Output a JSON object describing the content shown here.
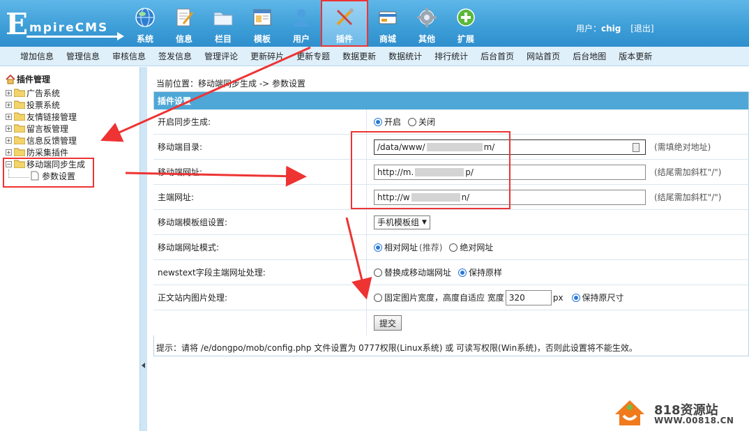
{
  "logo": {
    "initial": "E",
    "rest": "mpireCMS"
  },
  "main_nav": [
    {
      "label": "系统",
      "icon": "globe-icon"
    },
    {
      "label": "信息",
      "icon": "document-pen-icon"
    },
    {
      "label": "栏目",
      "icon": "folder-icon"
    },
    {
      "label": "模板",
      "icon": "window-icon"
    },
    {
      "label": "用户",
      "icon": "user-icon"
    },
    {
      "label": "插件",
      "icon": "tools-icon",
      "active": true
    },
    {
      "label": "商城",
      "icon": "card-icon"
    },
    {
      "label": "其他",
      "icon": "gear-icon"
    },
    {
      "label": "扩展",
      "icon": "plus-icon"
    }
  ],
  "user": {
    "prefix": "用户：",
    "name": "chig",
    "logout": "[退出]"
  },
  "sub_nav": [
    "增加信息",
    "管理信息",
    "审核信息",
    "签发信息",
    "管理评论",
    "更新碎片",
    "更新专题",
    "数据更新",
    "数据统计",
    "排行统计",
    "后台首页",
    "网站首页",
    "后台地图",
    "版本更新"
  ],
  "sidebar": {
    "title": "插件管理",
    "items": [
      "广告系统",
      "投票系统",
      "友情链接管理",
      "留言板管理",
      "信息反馈管理",
      "防采集插件",
      "移动端同步生成"
    ],
    "child": "参数设置"
  },
  "breadcrumb": "当前位置：移动端同步生成 -> 参数设置",
  "form": {
    "header": "插件设置",
    "sync_label": "开启同步生成:",
    "sync_on": "开启",
    "sync_off": "关闭",
    "dir_label": "移动端目录:",
    "dir_value": "/data/www/",
    "dir_value_end": "m/",
    "dir_note": "(需填绝对地址)",
    "mobile_url_label": "移动端网址:",
    "mobile_url_value": "http://m.",
    "mobile_url_end": "p/",
    "mobile_url_note": "(结尾需加斜杠\"/\")",
    "main_url_label": "主端网址:",
    "main_url_value": "http://w",
    "main_url_end": "n/",
    "main_url_note": "(结尾需加斜杠\"/\")",
    "template_label": "移动端模板组设置:",
    "template_value": "手机模板组",
    "url_mode_label": "移动端网址模式:",
    "url_mode_relative": "相对网址",
    "url_mode_relative_hint": "(推荐)",
    "url_mode_absolute": "绝对网址",
    "newstext_label": "newstext字段主端网址处理:",
    "newstext_replace": "替换成移动端网址",
    "newstext_keep": "保持原样",
    "image_label": "正文站内图片处理:",
    "image_fixed": "固定图片宽度，高度自适应 宽度",
    "image_width": "320",
    "image_unit": "px",
    "image_keep": "保持原尺寸",
    "submit": "提交"
  },
  "tip": "提示：请将 /e/dongpo/mob/config.php 文件设置为 0777权限(Linux系统) 或 可读写权限(Win系统)，否则此设置将不能生效。",
  "watermark": {
    "name": "818资源站",
    "url": "WWW.00818.CN"
  },
  "colors": {
    "header": "#3f9fd8",
    "subnav": "#dff0fb",
    "table_head": "#4ea7d6",
    "annotation_red": "#e33333"
  }
}
